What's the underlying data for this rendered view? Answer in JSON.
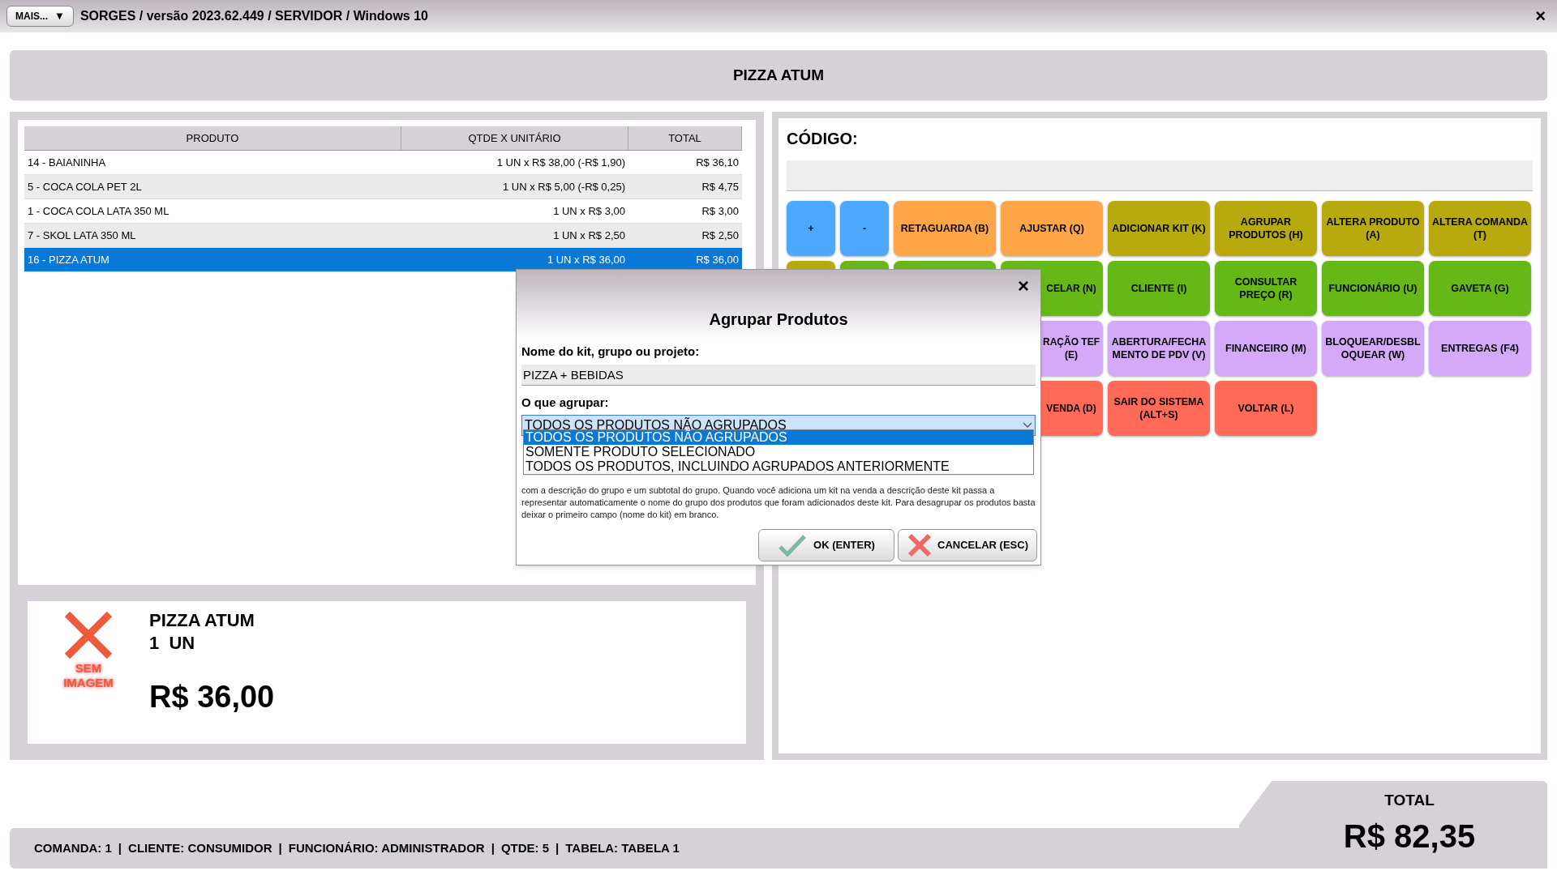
{
  "window": {
    "menu_button": "MAIS...",
    "menu_caret": "▼",
    "title": "SORGES / versão 2023.62.449 / SERVIDOR / Windows 10",
    "close": "×"
  },
  "header": {
    "title": "PIZZA ATUM"
  },
  "table": {
    "columns": [
      "PRODUTO",
      "QTDE X UNITÁRIO",
      "TOTAL"
    ],
    "rows": [
      {
        "product": "14 - BAIANINHA",
        "qty": "1 UN x R$ 38,00 (-R$ 1,90)",
        "total": "R$ 36,10",
        "selected": false
      },
      {
        "product": "5 - COCA COLA PET 2L",
        "qty": "1 UN x R$ 5,00 (-R$ 0,25)",
        "total": "R$ 4,75",
        "selected": false
      },
      {
        "product": "1 - COCA COLA LATA 350 ML",
        "qty": "1 UN x R$ 3,00",
        "total": "R$ 3,00",
        "selected": false
      },
      {
        "product": "7 - SKOL LATA 350 ML",
        "qty": "1 UN x R$ 2,50",
        "total": "R$ 2,50",
        "selected": false
      },
      {
        "product": "16 - PIZZA ATUM",
        "qty": "1 UN x R$ 36,00",
        "total": "R$ 36,00",
        "selected": true
      }
    ]
  },
  "product_panel": {
    "no_image": "SEM IMAGEM",
    "name": "PIZZA ATUM",
    "quantity": "1  UN",
    "price": "R$ 36,00"
  },
  "code": {
    "label": "CÓDIGO:"
  },
  "button_rows": [
    [
      {
        "kind": "full",
        "label": "+",
        "color": "#4da9ff"
      },
      {
        "kind": "full",
        "label": "-",
        "color": "#4da9ff"
      },
      {
        "kind": "full",
        "label": "RETAGUARDA (B)",
        "color": "#ffa748"
      },
      {
        "kind": "full",
        "label": "AJUSTAR (Q)",
        "color": "#ffa748"
      },
      {
        "kind": "full",
        "label": "ADICIONAR KIT (K)",
        "color": "#b8a90e"
      },
      {
        "kind": "full",
        "label": "AGRUPAR PRODUTOS (H)",
        "color": "#b8a90e"
      },
      {
        "kind": "full",
        "label": "ALTERA PRODUTO (A)",
        "color": "#b8a90e"
      },
      {
        "kind": "full",
        "label": "ALTERA COMANDA (T)",
        "color": "#b8a90e"
      }
    ],
    [
      {
        "kind": "covered",
        "color": "#b8a90e"
      },
      {
        "kind": "covered",
        "color": "#66b816"
      },
      {
        "kind": "covered",
        "color": "#66b816"
      },
      {
        "kind": "partial",
        "label": "CELAR (N)",
        "color": "#66b816"
      },
      {
        "kind": "full",
        "label": "CLIENTE (I)",
        "color": "#66b816"
      },
      {
        "kind": "full",
        "label": "CONSULTAR PREÇO (R)",
        "color": "#66b816"
      },
      {
        "kind": "full",
        "label": "FUNCIONÁRIO (U)",
        "color": "#66b816"
      },
      {
        "kind": "full",
        "label": "GAVETA (G)",
        "color": "#66b816"
      }
    ],
    [
      {
        "kind": "partial",
        "label": "RAÇÃO TEF (E)",
        "color": "#d4a9f7"
      },
      {
        "kind": "full",
        "label": "ABERTURA/FECHAMENTO DE PDV (V)",
        "color": "#d4a9f7"
      },
      {
        "kind": "full",
        "label": "FINANCEIRO (M)",
        "color": "#d4a9f7"
      },
      {
        "kind": "full",
        "label": "BLOQUEAR/DESBLOQUEAR (W)",
        "color": "#d4a9f7"
      },
      {
        "kind": "full",
        "label": "ENTREGAS (F4)",
        "color": "#d4a9f7"
      }
    ],
    [
      {
        "kind": "partial",
        "label": "VENDA (D)",
        "color": "#ff6b58"
      },
      {
        "kind": "full",
        "label": "SAIR DO SISTEMA (ALT+S)",
        "color": "#ff6b58"
      },
      {
        "kind": "full",
        "label": "VOLTAR (L)",
        "color": "#ff6b58"
      }
    ]
  ],
  "status_bar": {
    "items": [
      "COMANDA: 1",
      "CLIENTE: CONSUMIDOR",
      "FUNCIONÁRIO: ADMINISTRADOR",
      "QTDE: 5",
      "TABELA: TABELA 1"
    ],
    "separator": "|"
  },
  "total": {
    "label": "TOTAL",
    "value": "R$ 82,35"
  },
  "dialog": {
    "title": "Agrupar Produtos",
    "close": "×",
    "name_label": "Nome do kit, grupo ou projeto:",
    "name_value": "PIZZA + BEBIDAS",
    "group_label": "O que agrupar:",
    "group_value": "TODOS OS PRODUTOS NÃO AGRUPADOS",
    "options": [
      {
        "label": "TODOS OS PRODUTOS NÃO AGRUPADOS",
        "selected": true
      },
      {
        "label": "SOMENTE PRODUTO SELECIONADO",
        "selected": false
      },
      {
        "label": "TODOS OS PRODUTOS, INCLUINDO AGRUPADOS ANTERIORMENTE",
        "selected": false
      }
    ],
    "description": "com a descrição do grupo e um subtotal do grupo. Quando você adiciona um kit na venda a descrição deste kit passa a representar automaticamente o nome do grupo dos produtos que foram adicionados deste kit. Para desagrupar os produtos basta deixar o primeiro campo (nome do kit) em branco.",
    "ok": "OK (ENTER)",
    "cancel": "CANCELAR (ESC)"
  }
}
